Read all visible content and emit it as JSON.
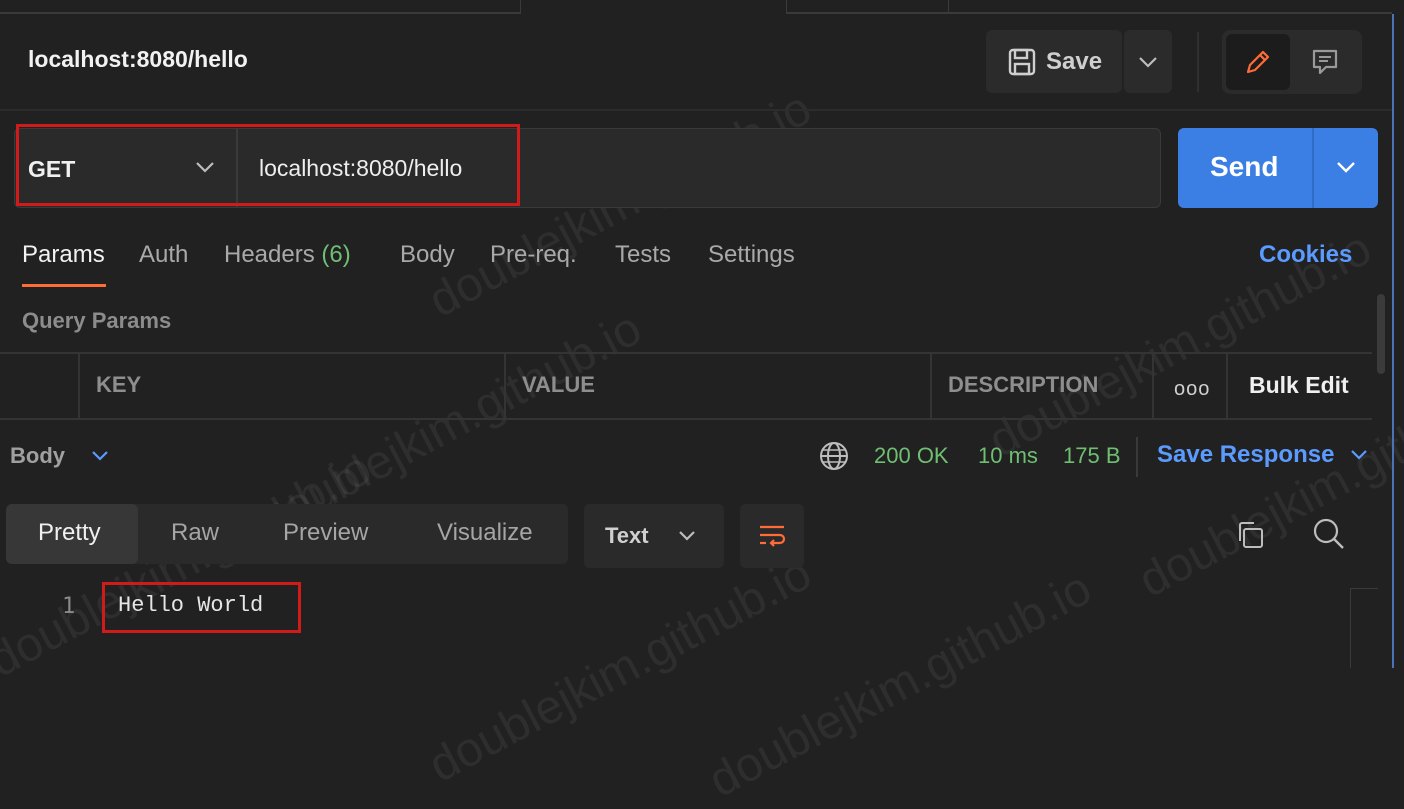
{
  "request": {
    "title": "localhost:8080/hello",
    "method": "GET",
    "url": "localhost:8080/hello"
  },
  "toolbar": {
    "save_label": "Save",
    "send_label": "Send"
  },
  "tabs": [
    {
      "label": "Params",
      "active": true
    },
    {
      "label": "Auth"
    },
    {
      "label": "Headers",
      "count": "(6)"
    },
    {
      "label": "Body"
    },
    {
      "label": "Pre-req."
    },
    {
      "label": "Tests"
    },
    {
      "label": "Settings"
    }
  ],
  "cookies_label": "Cookies",
  "query_params": {
    "title": "Query Params",
    "columns": [
      "KEY",
      "VALUE",
      "DESCRIPTION"
    ],
    "more_label": "ooo",
    "bulk_edit_label": "Bulk Edit"
  },
  "response": {
    "section_label": "Body",
    "status": "200 OK",
    "time": "10 ms",
    "size": "175 B",
    "save_response_label": "Save Response",
    "view_tabs": [
      "Pretty",
      "Raw",
      "Preview",
      "Visualize"
    ],
    "active_view": "Pretty",
    "format": "Text",
    "lines": [
      {
        "number": "1",
        "text": "Hello World"
      }
    ]
  },
  "watermark": "doublejkim.github.io",
  "colors": {
    "accent_send": "#3c7fe4",
    "active_tab_underline": "#ff6c37",
    "link": "#5b9bff",
    "status_ok": "#6fbf73",
    "highlight_box": "#d11a1a"
  }
}
